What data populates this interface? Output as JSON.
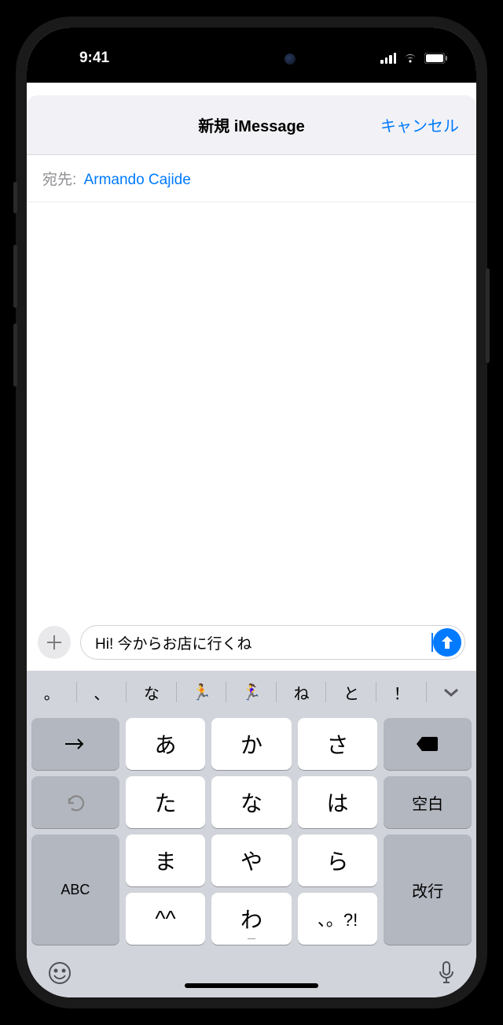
{
  "status": {
    "time": "9:41"
  },
  "nav": {
    "title": "新規 iMessage",
    "cancel": "キャンセル"
  },
  "recipient": {
    "label": "宛先:",
    "name": "Armando Cajide"
  },
  "compose": {
    "text": "Hi! 今からお店に行くね"
  },
  "suggestions": [
    "。",
    "、",
    "な",
    "🏃",
    "🏃‍♀️",
    "ね",
    "と",
    "！"
  ],
  "keys": {
    "r1": [
      "あ",
      "か",
      "さ"
    ],
    "r2": [
      "た",
      "な",
      "は"
    ],
    "r3": [
      "ま",
      "や",
      "ら"
    ],
    "r4": [
      "^^",
      "わ",
      "、。?!"
    ],
    "abc": "ABC",
    "space": "空白",
    "enter": "改行"
  }
}
